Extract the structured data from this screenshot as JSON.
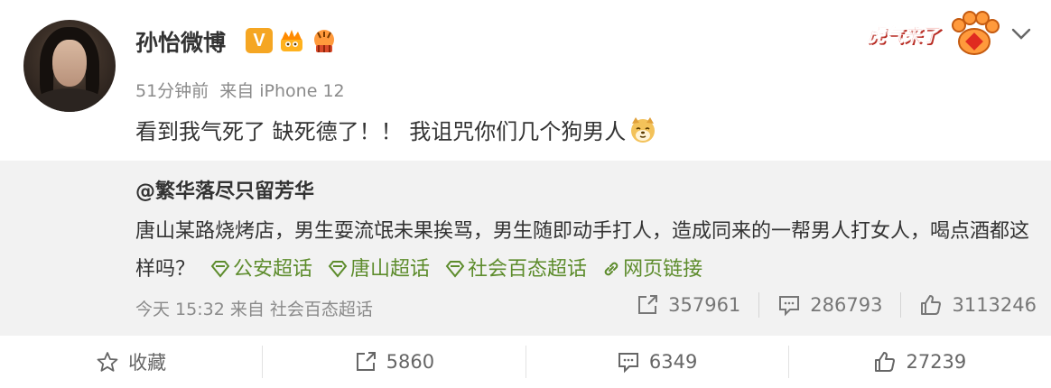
{
  "post": {
    "username": "孙怡微博",
    "verified_badge": "V",
    "time": "51分钟前",
    "source": "来自 iPhone 12",
    "text": "看到我气死了 缺死德了！！ 我诅咒你们几个狗男人",
    "emoji": "dog-face-icon"
  },
  "promo": {
    "text": "虎气来了"
  },
  "repost": {
    "author": "@繁华落尽只留芳华",
    "text": "唐山某路烧烤店，男生耍流氓未果挨骂，男生随即动手打人，造成同来的一帮男人打女人，喝点酒都这样吗？",
    "topics": [
      "公安超话",
      "唐山超话",
      "社会百态超话",
      "网页链接"
    ],
    "time": "今天 15:32",
    "source": "来自 社会百态超话",
    "stats": {
      "reposts": "357961",
      "comments": "286793",
      "likes": "3113246"
    }
  },
  "actions": {
    "favorite_label": "收藏",
    "repost_count": "5860",
    "comment_count": "6349",
    "like_count": "27239"
  },
  "colors": {
    "topic_green": "#5d8c2c",
    "verified_orange": "#f5a623",
    "repost_bg": "#f2f2f2"
  }
}
